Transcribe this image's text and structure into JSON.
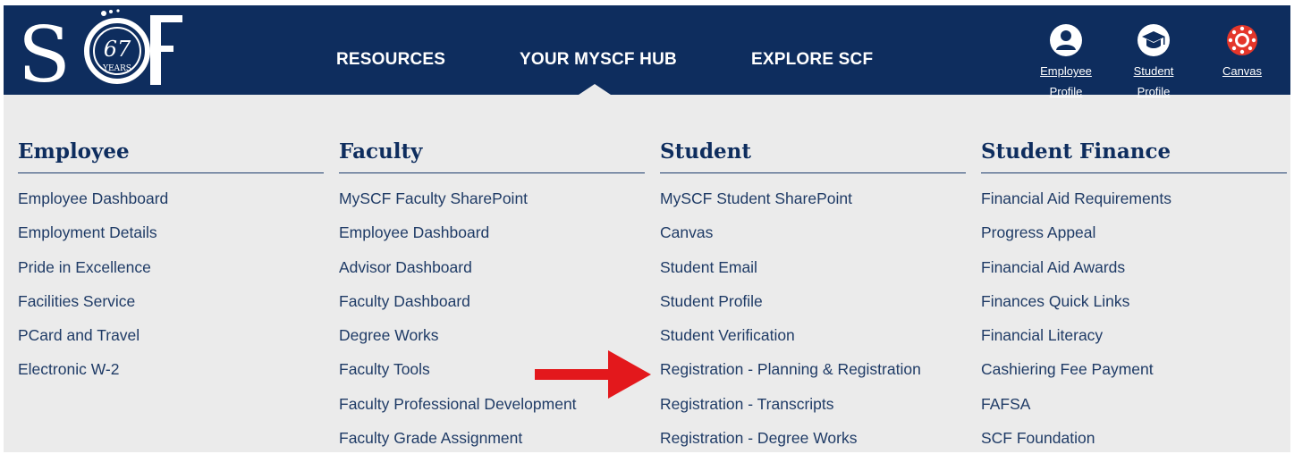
{
  "header": {
    "logo": {
      "text": "SCF",
      "badge_number": "67",
      "badge_label": "YEARS"
    },
    "nav": [
      {
        "label": "RESOURCES"
      },
      {
        "label": "YOUR MYSCF HUB"
      },
      {
        "label": "EXPLORE SCF"
      }
    ],
    "shortcuts": {
      "employee": {
        "line1": "Employee",
        "line2": "Profile",
        "icon": "person-icon"
      },
      "student": {
        "line1": "Student",
        "line2": "Profile",
        "icon": "graduation-cap-icon"
      },
      "canvas": {
        "label": "Canvas",
        "icon": "canvas-logo-icon"
      }
    }
  },
  "columns": [
    {
      "title": "Employee",
      "items": [
        "Employee Dashboard",
        "Employment Details",
        "Pride in Excellence",
        "Facilities Service",
        "PCard and Travel",
        "Electronic W-2"
      ]
    },
    {
      "title": "Faculty",
      "items": [
        "MySCF Faculty SharePoint",
        "Employee Dashboard",
        "Advisor Dashboard",
        "Faculty Dashboard",
        "Degree Works",
        "Faculty Tools",
        "Faculty Professional Development",
        "Faculty Grade Assignment"
      ]
    },
    {
      "title": "Student",
      "items": [
        "MySCF Student SharePoint",
        "Canvas",
        "Student Email",
        "Student Profile",
        "Student Verification",
        "Registration - Planning & Registration",
        "Registration - Transcripts",
        "Registration - Degree Works"
      ]
    },
    {
      "title": "Student Finance",
      "items": [
        "Financial Aid Requirements",
        "Progress Appeal",
        "Financial Aid Awards",
        "Finances Quick Links",
        "Financial Literacy",
        "Cashiering Fee Payment",
        "FAFSA",
        "SCF Foundation"
      ]
    }
  ],
  "colors": {
    "header_bg": "#0e2d5e",
    "panel_bg": "#ebebeb",
    "link": "#1f3b66",
    "arrow": "#e3181c",
    "canvas_icon": "#e4362a"
  }
}
